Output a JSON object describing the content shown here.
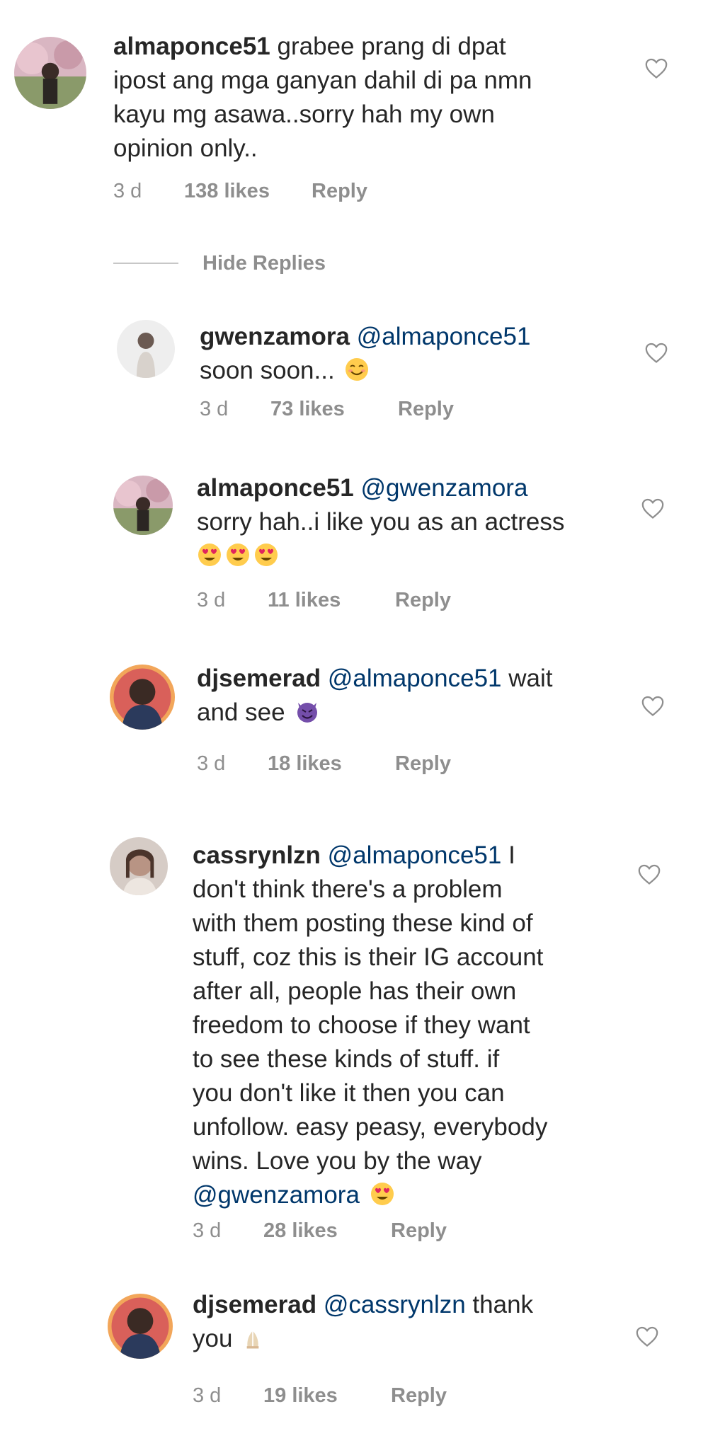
{
  "comments": [
    {
      "username": "almaponce51",
      "mention": "",
      "lines": [
        "grabee prang di dpat",
        "ipost ang mga ganyan dahil di pa nmn",
        "kayu mg asawa..sorry hah my own",
        "opinion only.."
      ],
      "time": "3 d",
      "likes": "138 likes",
      "reply": "Reply"
    },
    {
      "username": "gwenzamora",
      "mention": "@almaponce51",
      "lines": [
        "",
        "soon soon..."
      ],
      "time": "3 d",
      "likes": "73 likes",
      "reply": "Reply"
    },
    {
      "username": "almaponce51",
      "mention": "@gwenzamora",
      "lines": [
        "",
        "sorry hah..i like you as an actress"
      ],
      "time": "3 d",
      "likes": "11 likes",
      "reply": "Reply"
    },
    {
      "username": "djsemerad",
      "mention": "@almaponce51",
      "lines": [
        "wait",
        "and see"
      ],
      "time": "3 d",
      "likes": "18 likes",
      "reply": "Reply"
    },
    {
      "username": "cassrynlzn",
      "mention": "@almaponce51",
      "lines": [
        "I",
        "don't think there's a problem",
        "with them posting these kind of",
        "stuff, coz this is their IG account",
        "after all, people has their own",
        "freedom to choose if they want",
        "to see these kinds of stuff. if",
        "you don't like it then you can",
        "unfollow. easy peasy, everybody",
        "wins. Love you by the way"
      ],
      "mention2": "@gwenzamora",
      "time": "3 d",
      "likes": "28 likes",
      "reply": "Reply"
    },
    {
      "username": "djsemerad",
      "mention": "@cassrynlzn",
      "lines": [
        "thank",
        "you"
      ],
      "time": "3 d",
      "likes": "19 likes",
      "reply": "Reply"
    }
  ],
  "hide_replies_label": "Hide Replies",
  "icons": {
    "heart": "heart-outline-icon",
    "smile": "smiling-face-emoji",
    "heart_eyes": "heart-eyes-emoji",
    "devil": "smiling-devil-emoji",
    "praying": "folded-hands-emoji"
  },
  "colors": {
    "text": "#262626",
    "mention": "#00376b",
    "meta": "#8e8e8e"
  }
}
